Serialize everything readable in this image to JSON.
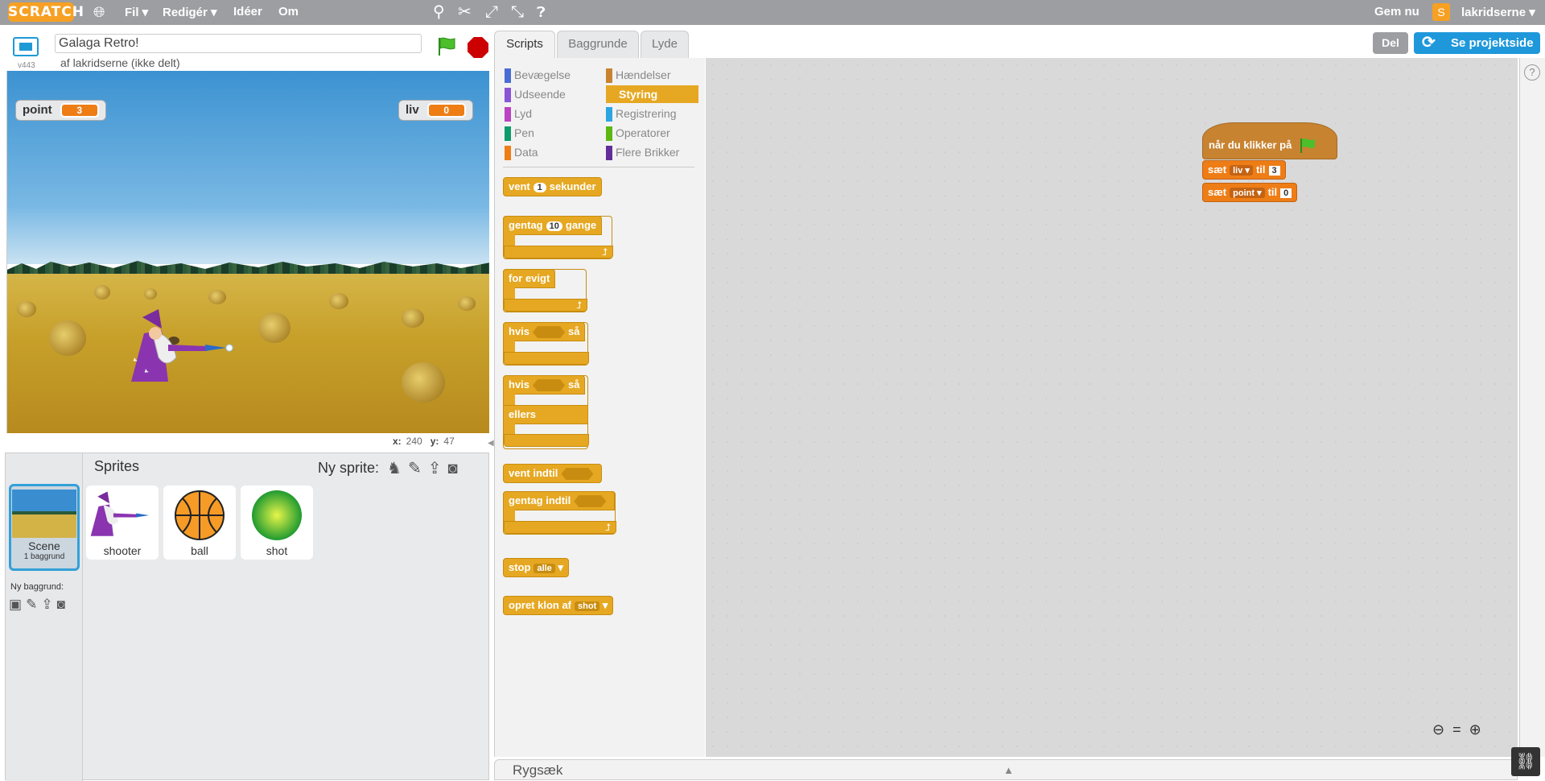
{
  "menubar": {
    "logo": "SCRATCH",
    "file": "Fil ▾",
    "edit": "Redigér ▾",
    "ideas": "Idéer",
    "about": "Om",
    "save_now": "Gem nu",
    "username": "lakridserne ▾"
  },
  "stage_header": {
    "version": "v443",
    "project_title": "Galaga Retro!",
    "author": "af lakridserne (ikke delt)"
  },
  "stage": {
    "variables": [
      {
        "name": "point",
        "value": "3"
      },
      {
        "name": "liv",
        "value": "0"
      }
    ],
    "coords": {
      "x_label": "x:",
      "x": "240",
      "y_label": "y:",
      "y": "47"
    }
  },
  "sprites_pane": {
    "header": "Sprites",
    "new_sprite": "Ny sprite:",
    "scene_label": "Scene",
    "scene_sub": "1 baggrund",
    "new_backdrop": "Ny baggrund:",
    "sprites": [
      {
        "name": "shooter"
      },
      {
        "name": "ball"
      },
      {
        "name": "shot"
      }
    ]
  },
  "tabs": [
    "Scripts",
    "Baggrunde",
    "Lyde"
  ],
  "actions": {
    "share": "Del",
    "project_page": "Se projektside"
  },
  "categories": [
    {
      "label": "Bevægelse",
      "color": "#4a6cd4"
    },
    {
      "label": "Hændelser",
      "color": "#c88330"
    },
    {
      "label": "Udseende",
      "color": "#8a55d7"
    },
    {
      "label": "Styring",
      "color": "#e6a822"
    },
    {
      "label": "Lyd",
      "color": "#bb42c3"
    },
    {
      "label": "Registrering",
      "color": "#2ca5e2"
    },
    {
      "label": "Pen",
      "color": "#0e9a6c"
    },
    {
      "label": "Operatorer",
      "color": "#5cb712"
    },
    {
      "label": "Data",
      "color": "#ee7d16"
    },
    {
      "label": "Flere Brikker",
      "color": "#632d99"
    }
  ],
  "palette_blocks": {
    "wait": {
      "pre": "vent",
      "val": "1",
      "post": "sekunder"
    },
    "repeat": {
      "pre": "gentag",
      "val": "10",
      "post": "gange"
    },
    "forever": "for evigt",
    "if_then": {
      "pre": "hvis",
      "post": "så"
    },
    "if_else": {
      "pre": "hvis",
      "post": "så",
      "else": "ellers"
    },
    "wait_until": "vent indtil",
    "repeat_until": "gentag indtil",
    "stop": {
      "pre": "stop",
      "dd": "alle"
    },
    "clone": {
      "pre": "opret klon af",
      "dd": "shot"
    }
  },
  "script": {
    "hat": "når du klikker på",
    "set1": {
      "pre": "sæt",
      "var": "liv",
      "mid": "til",
      "val": "3"
    },
    "set2": {
      "pre": "sæt",
      "var": "point",
      "mid": "til",
      "val": "0"
    }
  },
  "backpack": "Rygsæk"
}
